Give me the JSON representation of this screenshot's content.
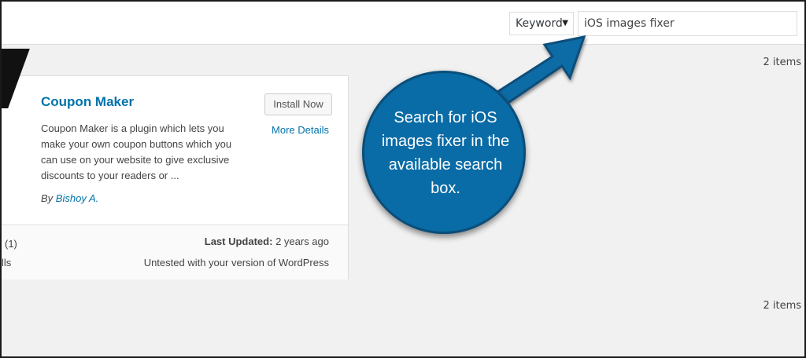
{
  "search": {
    "type_value": "Keyword",
    "query_value": "iOS images fixer"
  },
  "results": {
    "count_top": "2 items",
    "count_bottom": "2 items"
  },
  "plugin": {
    "name": "Coupon Maker",
    "install_label": "Install Now",
    "more_details_label": "More Details",
    "description": "Coupon Maker is a plugin which lets you make your own coupon buttons which you can use on your website to give exclusive discounts to your readers or ...",
    "author_prefix": "By",
    "author_name": "Bishoy A.",
    "last_updated_label": "Last Updated:",
    "last_updated_value": "2 years ago",
    "compatibility": "Untested with your version of WordPress",
    "rating_count_partial": "(1)",
    "installs_partial": "lls"
  },
  "callout": {
    "text": "Search for iOS images fixer in the available search box.",
    "fill_color": "#0a6ca6",
    "border_color": "#0b4e7a"
  }
}
